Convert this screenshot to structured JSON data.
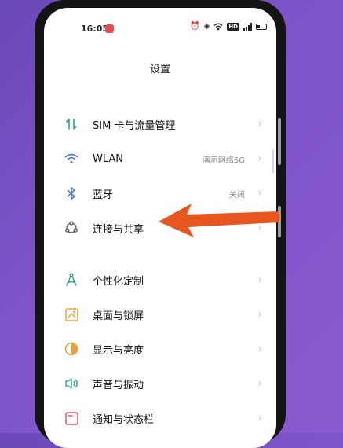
{
  "status_bar": {
    "time": "16:05",
    "icons": [
      "alarm-icon",
      "vibrate-icon",
      "wifi-icon",
      "hd-badge",
      "signal-icon",
      "battery-icon"
    ],
    "hd": "HD"
  },
  "header": {
    "title": "设置"
  },
  "settings": {
    "items": [
      {
        "label": "SIM 卡与流量管理",
        "value": "",
        "icon": "sim-data-icon"
      },
      {
        "label": "WLAN",
        "value": "演示网络5G",
        "icon": "wifi-icon"
      },
      {
        "label": "蓝牙",
        "value": "关闭",
        "icon": "bluetooth-icon"
      },
      {
        "label": "连接与共享",
        "value": "",
        "icon": "connection-share-icon"
      },
      {
        "label": "个性化定制",
        "value": "",
        "icon": "personalize-icon"
      },
      {
        "label": "桌面与锁屏",
        "value": "",
        "icon": "desktop-lockscreen-icon"
      },
      {
        "label": "显示与亮度",
        "value": "",
        "icon": "display-brightness-icon"
      },
      {
        "label": "声音与振动",
        "value": "",
        "icon": "sound-vibration-icon"
      },
      {
        "label": "通知与状态栏",
        "value": "",
        "icon": "notification-statusbar-icon"
      }
    ]
  },
  "colors": {
    "background": "#7b52c4",
    "accent_green": "#2aa889",
    "arrow": "#e8561f",
    "bluetooth": "#3f6ed6",
    "desktop_orange": "#f0a032",
    "notification_red": "#e9566c"
  }
}
